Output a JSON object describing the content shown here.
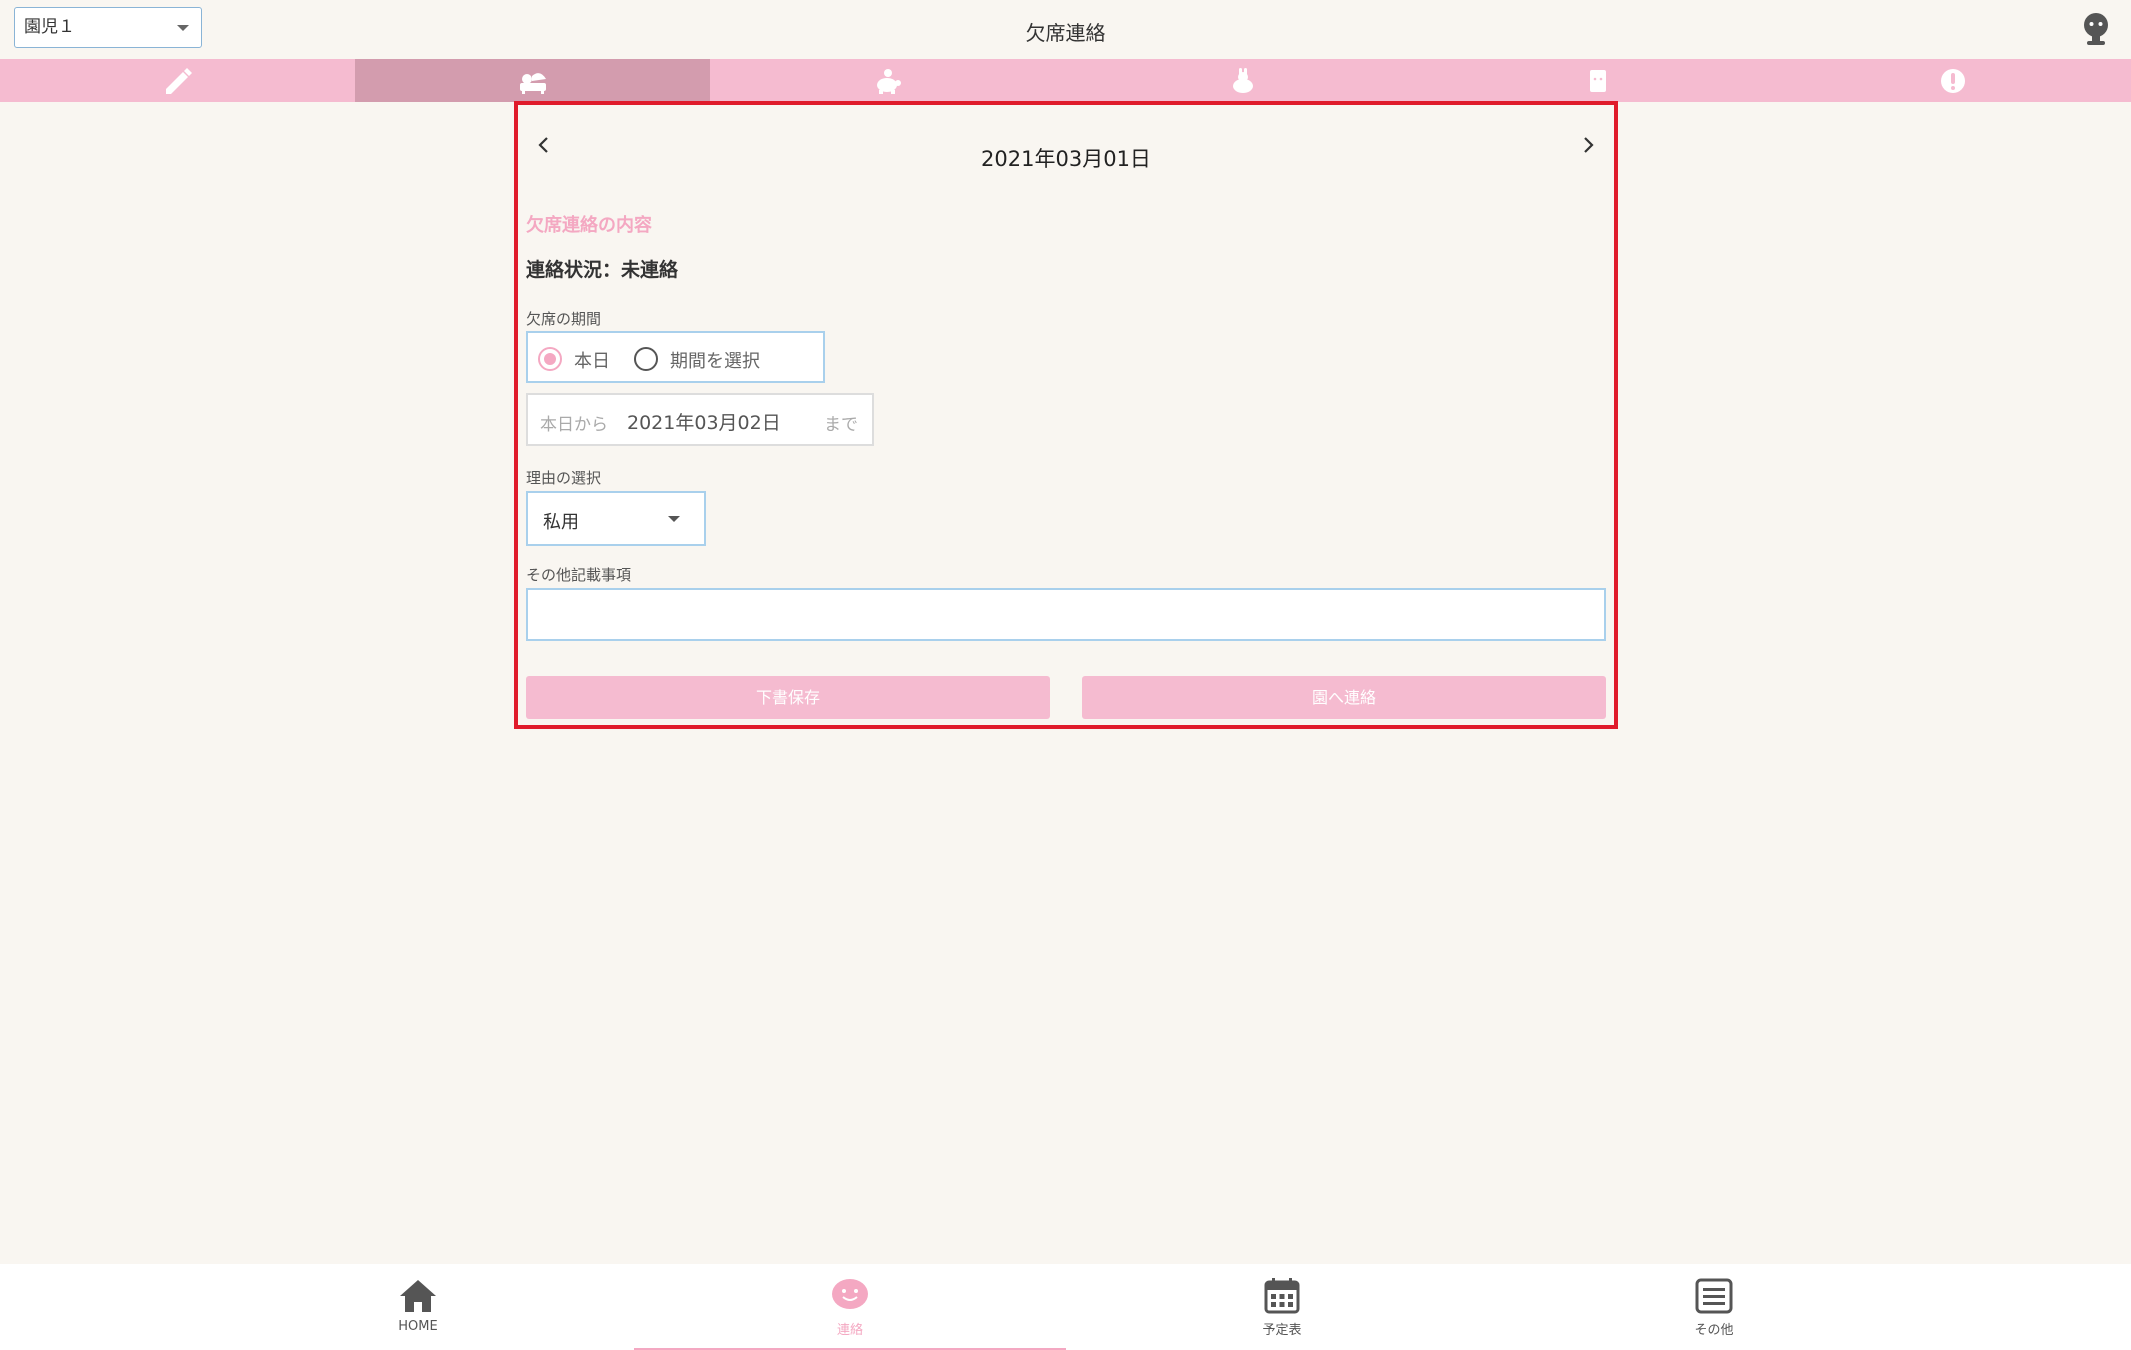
{
  "header": {
    "child_select": "園児１",
    "title": "欠席連絡"
  },
  "tabs": [
    {
      "icon": "pencil-icon",
      "active": false
    },
    {
      "icon": "sick-bed-icon",
      "active": true
    },
    {
      "icon": "tortoise-icon",
      "active": false
    },
    {
      "icon": "rabbit-icon",
      "active": false
    },
    {
      "icon": "note-icon",
      "active": false
    },
    {
      "icon": "alert-icon",
      "active": false
    }
  ],
  "form": {
    "date": "2021年03月01日",
    "section_heading": "欠席連絡の内容",
    "status": "連絡状況：未連絡",
    "period_label": "欠席の期間",
    "period_options": [
      "本日",
      "期間を選択"
    ],
    "period_selected": "本日",
    "range_prefix": "本日から",
    "range_date": "2021年03月02日",
    "range_suffix": "まで",
    "reason_label": "理由の選択",
    "reason_value": "私用",
    "notes_label": "その他記載事項",
    "notes_value": "",
    "draft_button": "下書保存",
    "send_button": "園へ連絡"
  },
  "bottom_nav": [
    {
      "label": "HOME",
      "icon": "home-icon",
      "active": false
    },
    {
      "label": "連絡",
      "icon": "chat-bubble-icon",
      "active": true
    },
    {
      "label": "予定表",
      "icon": "calendar-icon",
      "active": false
    },
    {
      "label": "その他",
      "icon": "menu-list-icon",
      "active": false
    }
  ],
  "colors": {
    "accent_pink": "#f5bbd0",
    "active_tab": "#d39cae",
    "text_pink": "#f4a8c2",
    "highlight_frame": "#e01b2b",
    "input_border": "#a9d0ec",
    "background": "#f9f6f1"
  }
}
